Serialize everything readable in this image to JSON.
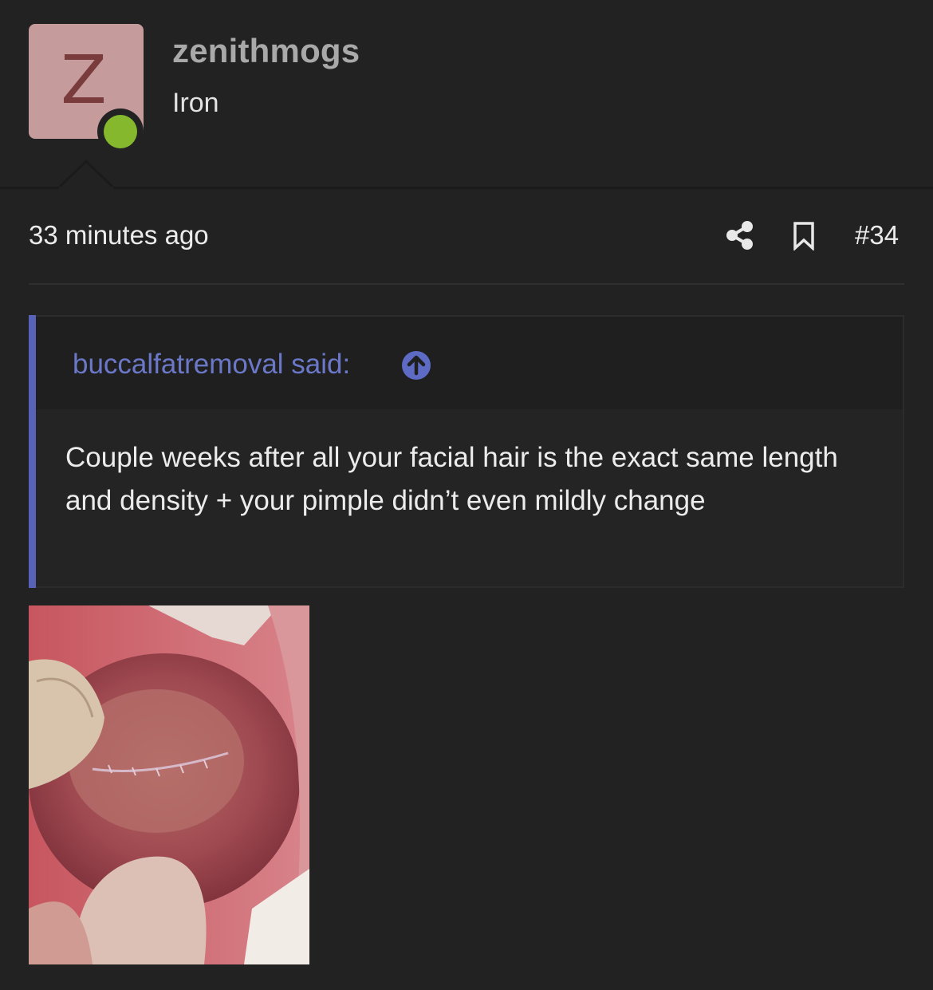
{
  "user": {
    "avatar_letter": "Z",
    "username": "zenithmogs",
    "title": "Iron",
    "online": true,
    "avatar_color": "#c69b9c",
    "online_color": "#85b82d"
  },
  "post": {
    "time": "33 minutes ago",
    "number": "#34",
    "share_icon": "share-icon",
    "bookmark_icon": "bookmark-icon"
  },
  "quote": {
    "author_line": "buccalfatremoval said:",
    "jump_icon": "arrow-up-circle-icon",
    "text": "Couple weeks after all your facial hair is the exact same length and density + your pimple didn’t even mildly change",
    "accent_color": "#5762b8"
  },
  "attachment": {
    "type": "photo"
  }
}
